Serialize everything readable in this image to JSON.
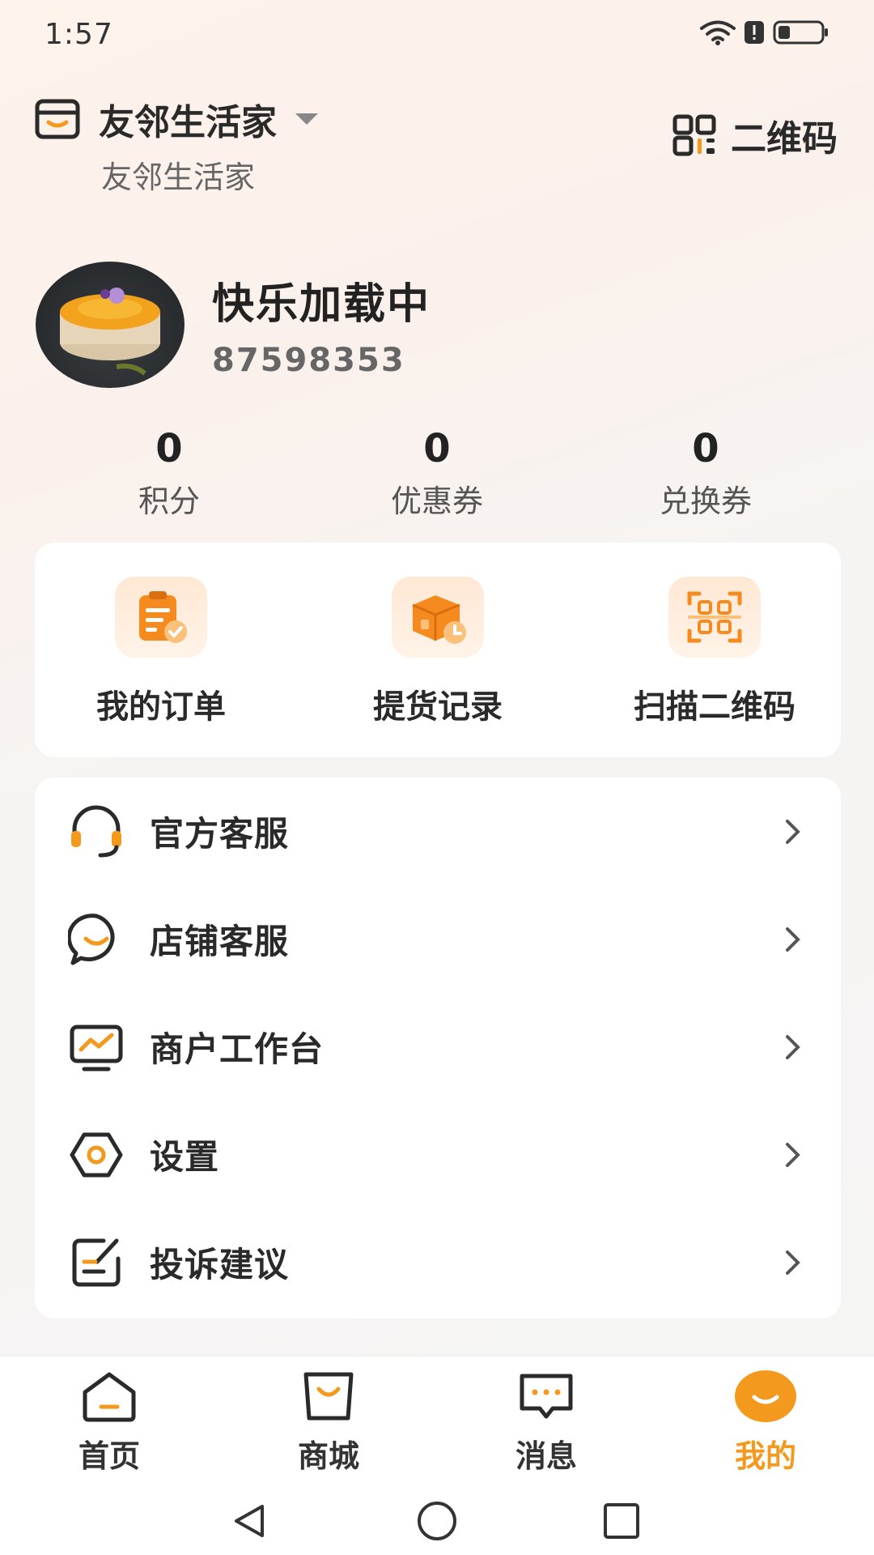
{
  "status_bar": {
    "time": "1:57"
  },
  "header": {
    "store_name": "友邻生活家",
    "store_subtitle": "友邻生活家",
    "qr_label": "二维码"
  },
  "profile": {
    "nickname": "快乐加载中",
    "user_id": "87598353"
  },
  "stats": [
    {
      "value": "0",
      "label": "积分"
    },
    {
      "value": "0",
      "label": "优惠券"
    },
    {
      "value": "0",
      "label": "兑换券"
    }
  ],
  "quick_actions": [
    {
      "label": "我的订单",
      "icon": "clipboard-check-icon"
    },
    {
      "label": "提货记录",
      "icon": "package-clock-icon"
    },
    {
      "label": "扫描二维码",
      "icon": "qr-scan-icon"
    }
  ],
  "menu": [
    {
      "label": "官方客服",
      "icon": "headset-icon"
    },
    {
      "label": "店铺客服",
      "icon": "chat-smile-icon"
    },
    {
      "label": "商户工作台",
      "icon": "monitor-chart-icon"
    },
    {
      "label": "设置",
      "icon": "hexagon-settings-icon"
    },
    {
      "label": "投诉建议",
      "icon": "edit-note-icon"
    }
  ],
  "tabs": [
    {
      "label": "首页",
      "icon": "home-icon"
    },
    {
      "label": "商城",
      "icon": "shopping-bag-icon"
    },
    {
      "label": "消息",
      "icon": "message-icon"
    },
    {
      "label": "我的",
      "icon": "profile-smile-icon",
      "active": true
    }
  ],
  "colors": {
    "accent": "#f39a1e",
    "icon_dark": "#2a2a2a",
    "background": "#f5f5f5"
  }
}
